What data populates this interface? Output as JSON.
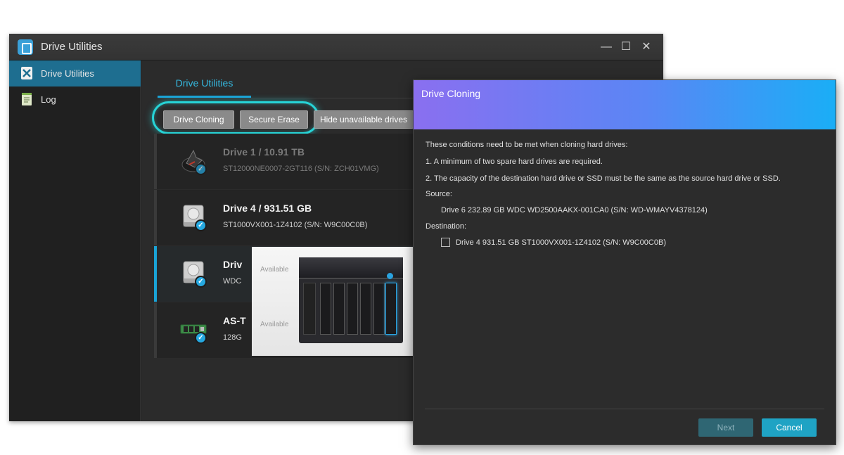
{
  "window": {
    "title": "Drive Utilities",
    "controls": [
      "—",
      "☐",
      "✕"
    ]
  },
  "sidebar": {
    "items": [
      {
        "label": "Drive Utilities",
        "icon": "tools-icon"
      },
      {
        "label": "Log",
        "icon": "log-icon"
      }
    ]
  },
  "main": {
    "tab": "Drive Utilities",
    "buttons": {
      "drive_cloning": "Drive Cloning",
      "secure_erase": "Secure Erase",
      "hide_unavailable": "Hide unavailable drives"
    },
    "drives": [
      {
        "name": "Drive 1 / 10.91 TB",
        "sub": "ST12000NE0007-2GT116 (S/N: ZCH01VMG)"
      },
      {
        "name": "Drive 4 / 931.51 GB",
        "sub": "ST1000VX001-1Z4102 (S/N: W9C00C0B)"
      },
      {
        "name": "Driv",
        "sub": "WDC"
      },
      {
        "name": "AS-T",
        "sub": "128G"
      }
    ],
    "popup": {
      "available_1": "Available",
      "available_2": "Available"
    }
  },
  "dialog": {
    "title": "Drive Cloning",
    "intro": "These conditions need to be met when cloning hard drives:",
    "condition_1": "1. A minimum of two spare hard drives are required.",
    "condition_2": "2. The capacity of the destination hard drive or SSD must be the same as the source hard drive or SSD.",
    "source_label": "Source:",
    "source_value": "Drive 6 232.89 GB WDC WD2500AAKX-001CA0 (S/N: WD-WMAYV4378124)",
    "destination_label": "Destination:",
    "destination_value": "Drive 4 931.51 GB ST1000VX001-1Z4102 (S/N: W9C00C0B)",
    "next_label": "Next",
    "cancel_label": "Cancel"
  },
  "colors": {
    "accent": "#1aa3d6",
    "highlight_ring": "#27d3d6",
    "cancel_button": "#1fa3c4",
    "next_button_disabled": "#2f6673"
  }
}
